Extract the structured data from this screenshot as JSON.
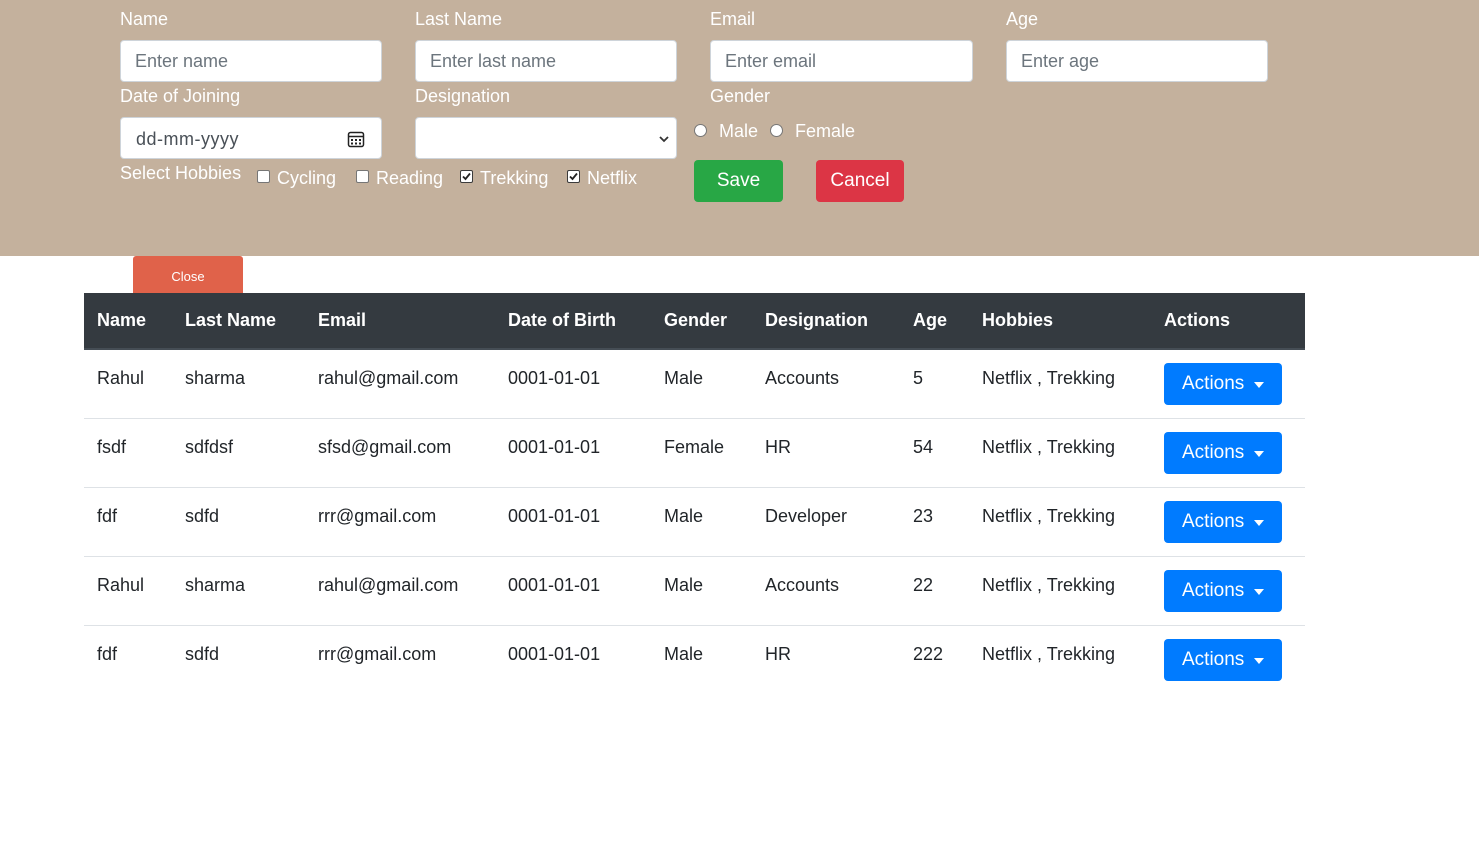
{
  "form": {
    "name_label": "Name",
    "name_placeholder": "Enter name",
    "lastname_label": "Last Name",
    "lastname_placeholder": "Enter last name",
    "email_label": "Email",
    "email_placeholder": "Enter email",
    "age_label": "Age",
    "age_placeholder": "Enter age",
    "doj_label": "Date of Joining",
    "doj_placeholder": "dd-mm-yyyy",
    "designation_label": "Designation",
    "designation_value": "",
    "gender_label": "Gender",
    "gender_options": [
      "Male",
      "Female"
    ],
    "hobbies_label": "Select Hobbies",
    "hobbies": [
      {
        "label": "Cycling",
        "checked": false
      },
      {
        "label": "Reading",
        "checked": false
      },
      {
        "label": "Trekking",
        "checked": true
      },
      {
        "label": "Netflix",
        "checked": true
      }
    ],
    "save_label": "Save",
    "cancel_label": "Cancel"
  },
  "close_label": "Close",
  "table": {
    "headers": [
      "Name",
      "Last Name",
      "Email",
      "Date of Birth",
      "Gender",
      "Designation",
      "Age",
      "Hobbies",
      "Actions"
    ],
    "rows": [
      {
        "name": "Rahul",
        "last": "sharma",
        "email": "rahul@gmail.com",
        "dob": "0001-01-01",
        "gender": "Male",
        "designation": "Accounts",
        "age": "5",
        "hobbies": "Netflix , Trekking",
        "action": "Actions"
      },
      {
        "name": "fsdf",
        "last": "sdfdsf",
        "email": "sfsd@gmail.com",
        "dob": "0001-01-01",
        "gender": "Female",
        "designation": "HR",
        "age": "54",
        "hobbies": "Netflix , Trekking",
        "action": "Actions"
      },
      {
        "name": "fdf",
        "last": "sdfd",
        "email": "rrr@gmail.com",
        "dob": "0001-01-01",
        "gender": "Male",
        "designation": "Developer",
        "age": "23",
        "hobbies": "Netflix , Trekking",
        "action": "Actions"
      },
      {
        "name": "Rahul",
        "last": "sharma",
        "email": "rahul@gmail.com",
        "dob": "0001-01-01",
        "gender": "Male",
        "designation": "Accounts",
        "age": "22",
        "hobbies": "Netflix , Trekking",
        "action": "Actions"
      },
      {
        "name": "fdf",
        "last": "sdfd",
        "email": "rrr@gmail.com",
        "dob": "0001-01-01",
        "gender": "Male",
        "designation": "HR",
        "age": "222",
        "hobbies": "Netflix , Trekking",
        "action": "Actions"
      }
    ]
  },
  "colors": {
    "panel_bg": "#c4b19d",
    "save": "#28a745",
    "cancel": "#dc3545",
    "close": "#e0624a",
    "table_header": "#343a40",
    "actions": "#007bff"
  },
  "icons": {
    "calendar": "calendar-icon",
    "select_arrow": "chevron-down-icon",
    "dropdown_caret": "caret-down-icon"
  }
}
